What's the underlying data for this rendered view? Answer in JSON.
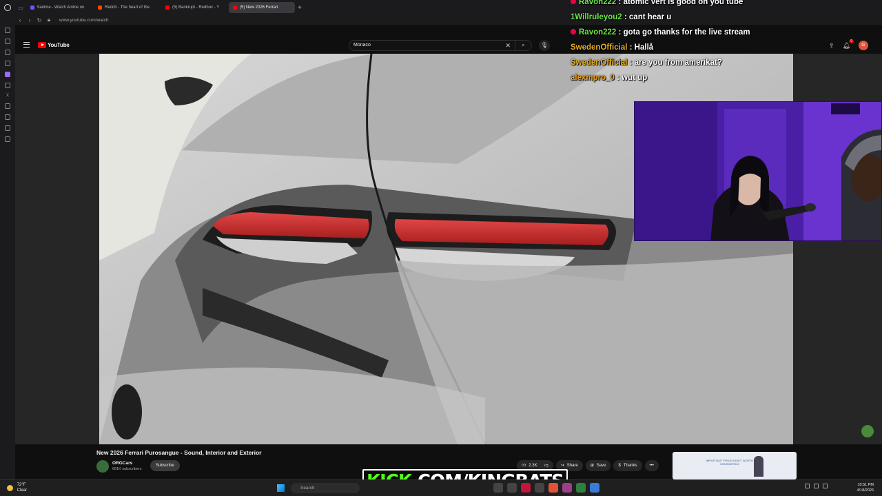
{
  "browser": {
    "tabs": [
      {
        "label": "9anime - Watch Anime on",
        "color": "#7c4dff",
        "active": false
      },
      {
        "label": "Reddit - The heart of the",
        "color": "#ff4500",
        "active": false
      },
      {
        "label": "(5) Bankrupt - Redbox - Y",
        "color": "#ff0000",
        "active": false
      },
      {
        "label": "(5) New 2026 Ferrari",
        "color": "#ff0000",
        "active": true
      }
    ],
    "new_tab_label": "+",
    "url": "www.youtube.com/watch"
  },
  "youtube": {
    "logo_text": "YouTube",
    "search_value": "Monaco",
    "notification_count": "9",
    "avatar_initial": "G",
    "video": {
      "title": "New 2026 Ferrari Purosangue - Sound, Interior and Exterior",
      "channel": "ORGCars",
      "subscribers": "681K subscribers",
      "subscribe_label": "Subscribe",
      "likes": "2.3K",
      "share_label": "Share",
      "save_label": "Save",
      "thanks_label": "Thanks",
      "more_label": "•••"
    },
    "ad_text": "IMPORTANT 'PRICE ASSET' WORTH CONSIDERING"
  },
  "stream": {
    "chat": [
      {
        "user": "Ravon222",
        "message": "atomic vert is good on you tube",
        "color": "#6ee64a",
        "badge": true
      },
      {
        "user": "1Willruleyou2",
        "message": "cant hear u",
        "color": "#6ee64a",
        "badge": false
      },
      {
        "user": "Ravon222",
        "message": "gota go thanks for the live stream",
        "color": "#6ee64a",
        "badge": true
      },
      {
        "user": "SwedenOfficial",
        "message": "Hallå",
        "color": "#e8b020",
        "badge": false
      },
      {
        "user": "SwedenOfficial",
        "message": "are you from amerikat?",
        "color": "#e8b020",
        "badge": false
      },
      {
        "user": "alexmpro_0",
        "message": "wut up",
        "color": "#e8a020",
        "badge": false
      }
    ],
    "kick_prefix": "KICK",
    "kick_suffix": ".COM/KINGBATS"
  },
  "taskbar": {
    "temperature": "72°F",
    "condition": "Clear",
    "search_placeholder": "Search",
    "time": "10:51 PM",
    "date": "4/18/2026"
  }
}
